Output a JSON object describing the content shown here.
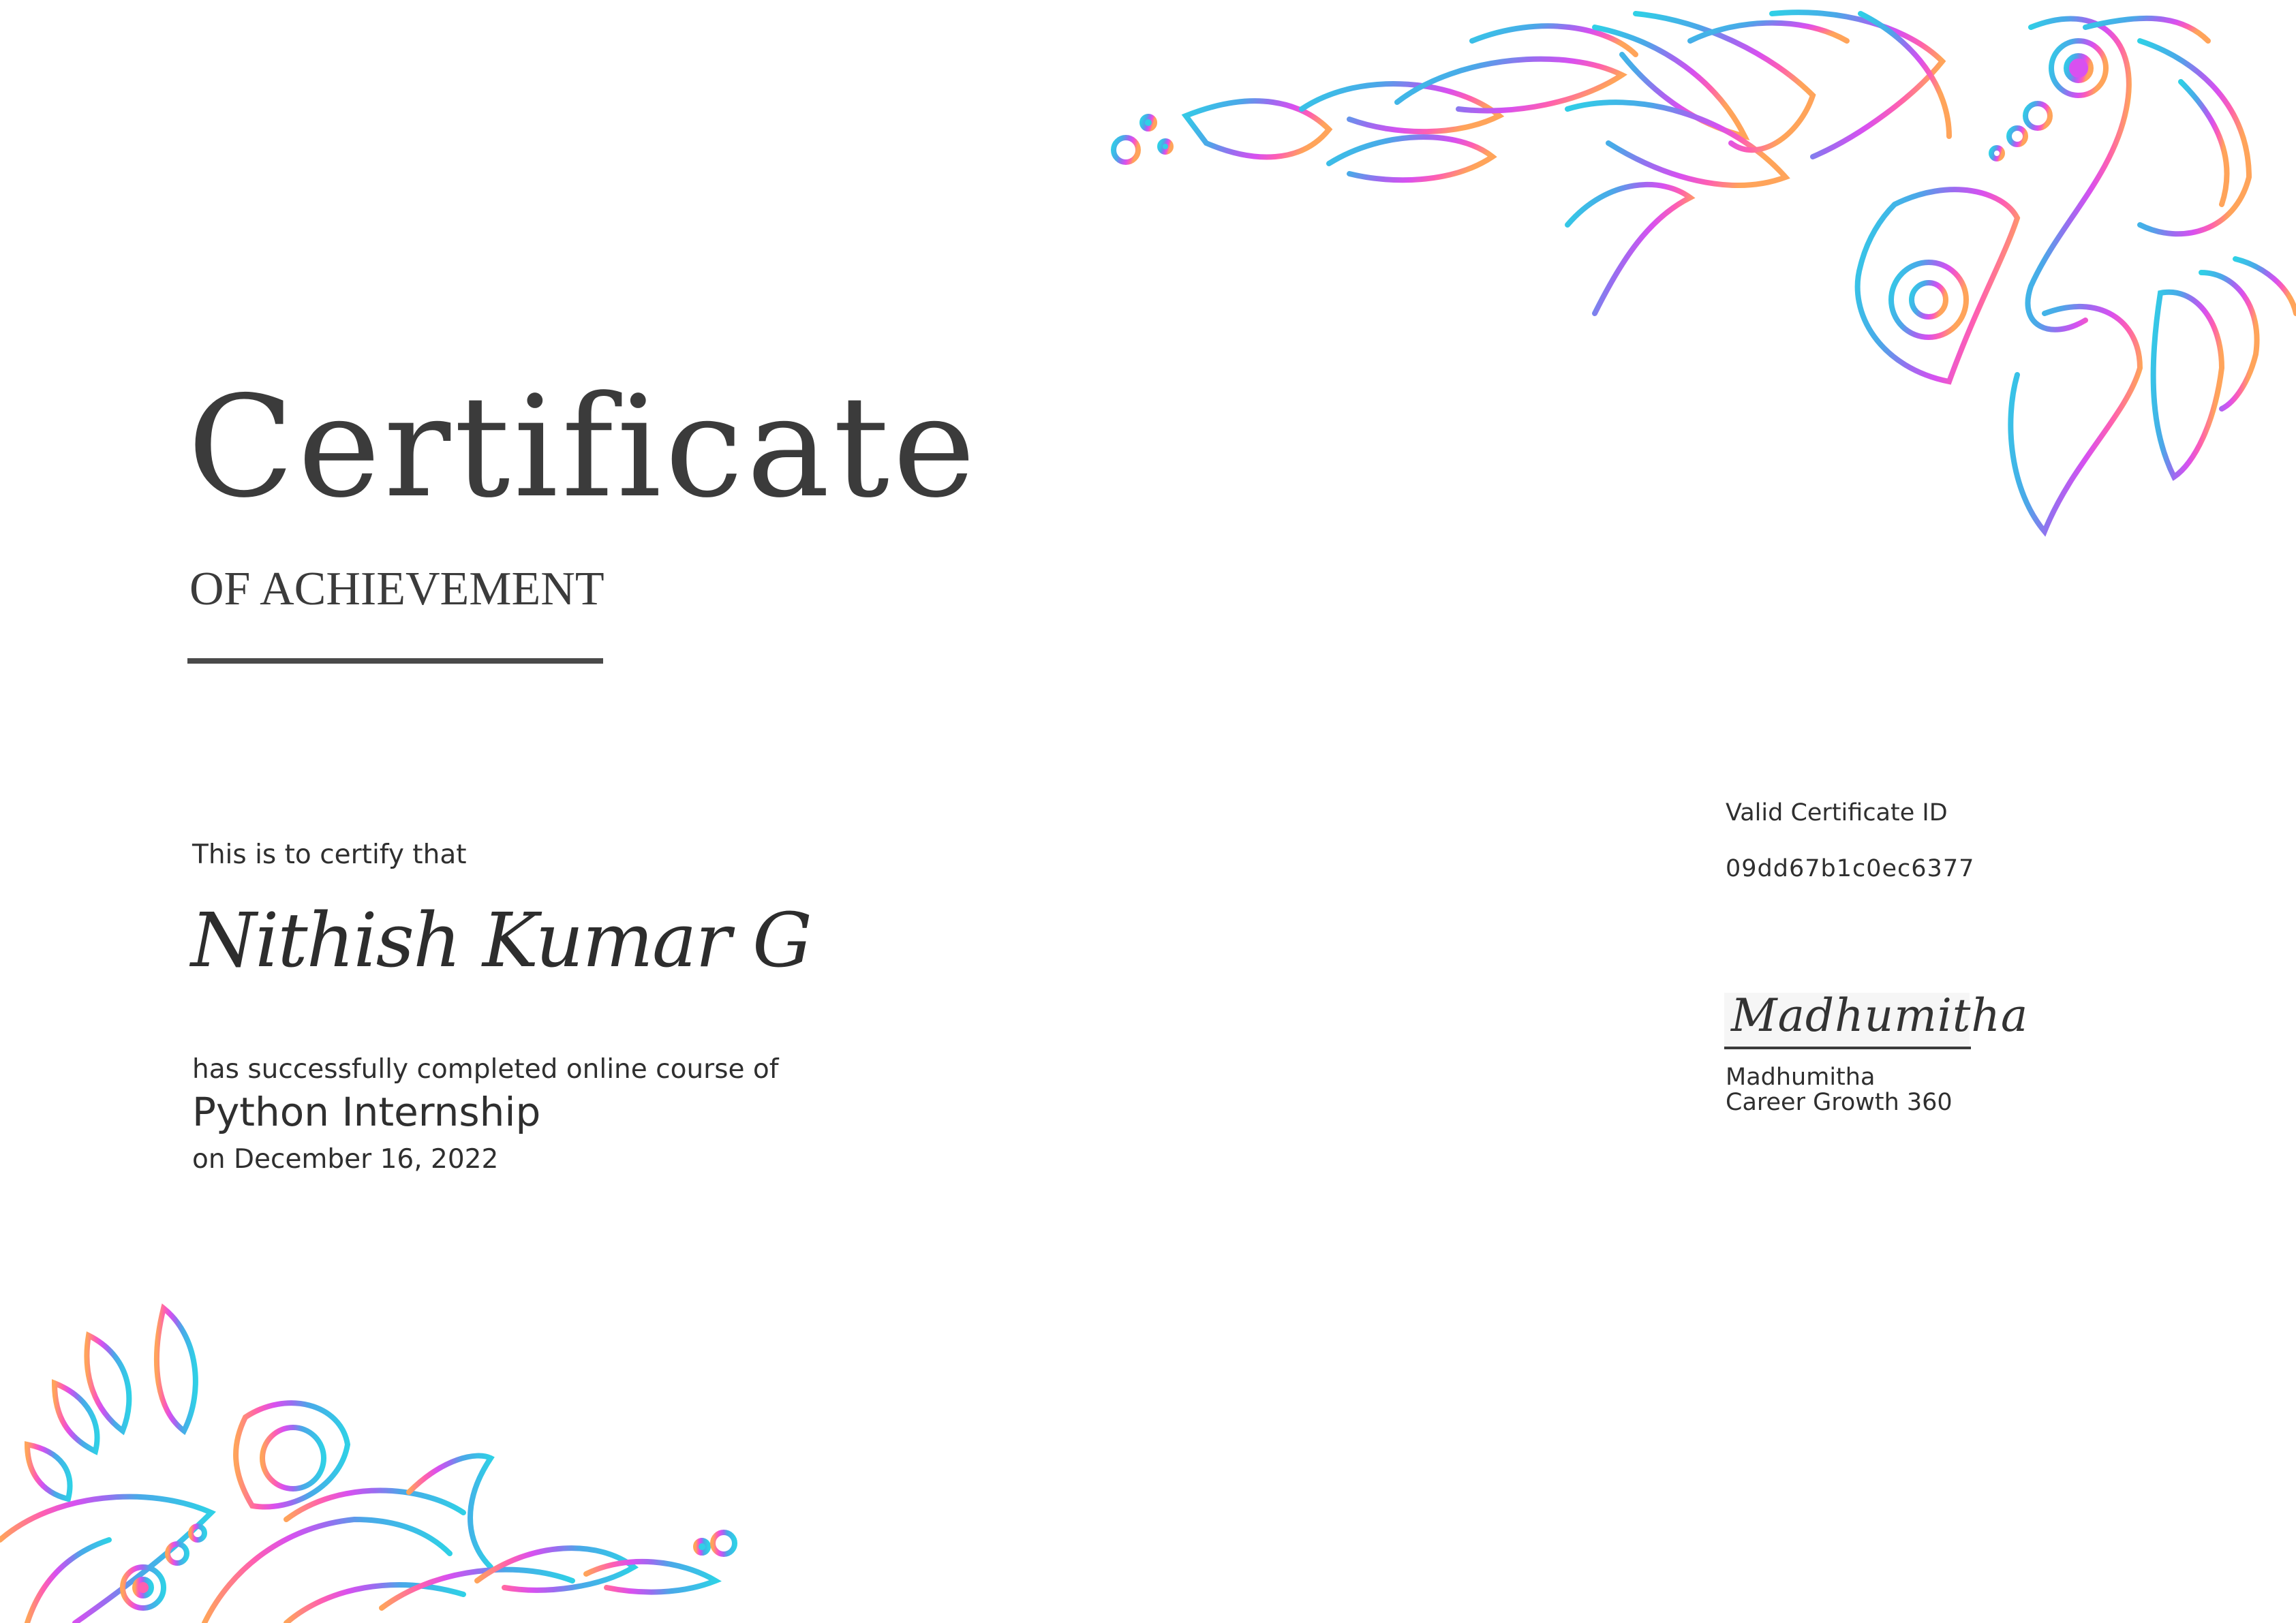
{
  "certificate": {
    "title": "Certificate",
    "subtitle": "OF ACHIEVEMENT",
    "intro": "This is to certify that",
    "recipient": "Nithish Kumar G",
    "completion_text": "has successfully completed online course of",
    "course": "Python Internship",
    "date_line": "on December 16, 2022"
  },
  "verification": {
    "label": "Valid Certificate ID",
    "id": "09dd67b1c0ec6377"
  },
  "signatory": {
    "signature": "Madhumitha",
    "name": "Madhumitha",
    "organization": "Career Growth 360"
  },
  "decoration": {
    "colors": [
      "#2fd0e6",
      "#4aa8e8",
      "#9a6cf0",
      "#d850f0",
      "#ff5fb0",
      "#ffa45a"
    ]
  }
}
